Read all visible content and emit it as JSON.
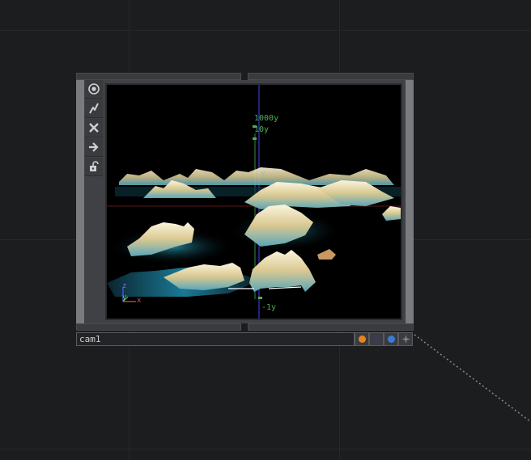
{
  "node": {
    "name": "cam1",
    "toolbar": [
      {
        "name": "viewer-active-icon",
        "glyph": "◎"
      },
      {
        "name": "bypass-icon",
        "glyph": "ϟ"
      },
      {
        "name": "close-icon",
        "glyph": "✕"
      },
      {
        "name": "export-arrow-icon",
        "glyph": "➔"
      },
      {
        "name": "lock-icon",
        "glyph": "🔓"
      }
    ],
    "viewer": {
      "labels": {
        "top_far": "1000y",
        "top_near": "10y",
        "mid": "y",
        "bottom": "-1y",
        "axis_z": "z",
        "axis_y": "y",
        "axis_x": "x"
      }
    },
    "flags": {
      "color_orange": "#e8821e",
      "color_dark": "#3a3c55",
      "color_blue": "#3a7bd5"
    }
  }
}
